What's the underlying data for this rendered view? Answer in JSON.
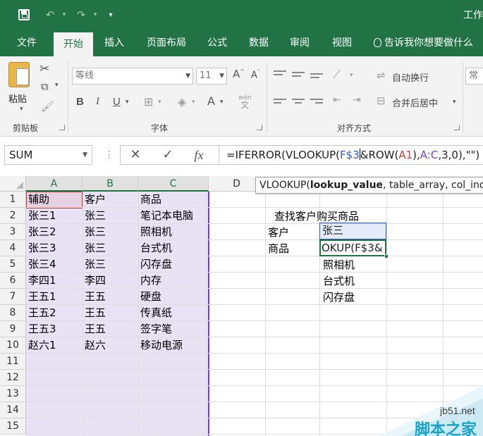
{
  "window": {
    "title": "工作",
    "qat": {
      "save_icon": "save-icon",
      "undo_icon": "undo-icon",
      "redo_icon": "redo-icon",
      "customize_icon": "chevron-down-icon"
    }
  },
  "tabs": [
    {
      "label": "文件"
    },
    {
      "label": "开始",
      "active": true
    },
    {
      "label": "插入"
    },
    {
      "label": "页面布局"
    },
    {
      "label": "公式"
    },
    {
      "label": "数据"
    },
    {
      "label": "审阅"
    },
    {
      "label": "视图"
    }
  ],
  "tell_me": "告诉我你想要做什么",
  "ribbon": {
    "clipboard": {
      "paste_label": "粘贴",
      "group_label": "剪贴板"
    },
    "font": {
      "name_value": "等线",
      "size_value": "11",
      "bold": "B",
      "italic": "I",
      "underline": "U",
      "grow": "A",
      "shrink": "A",
      "font_color": "A",
      "phonetic": "wén",
      "group_label": "字体"
    },
    "alignment": {
      "wrap_label": "自动换行",
      "merge_label": "合并后居中",
      "group_label": "对齐方式"
    },
    "number": {
      "format_value": "常规"
    }
  },
  "formula_bar": {
    "name_box": "SUM",
    "cancel": "✕",
    "enter": "✓",
    "fx": "fx",
    "formula_parts": [
      "=IFERROR(VLOOKUP(",
      "F$3",
      "&ROW(",
      "A1",
      "),",
      "A:C",
      ",3,0),\"\")"
    ]
  },
  "tooltip": {
    "func": "VLOOKUP(",
    "arg_bold": "lookup_value",
    "rest": ", table_array, col_ind"
  },
  "grid": {
    "columns": [
      "A",
      "B",
      "C",
      "D"
    ],
    "rows": [
      "1",
      "2",
      "3",
      "4",
      "5",
      "6",
      "7",
      "8",
      "9",
      "10",
      "11",
      "12",
      "13",
      "14",
      "15"
    ],
    "table": [
      [
        "辅助",
        "客户",
        "商品"
      ],
      [
        "张三1",
        "张三",
        "笔记本电脑"
      ],
      [
        "张三2",
        "张三",
        "照相机"
      ],
      [
        "张三3",
        "张三",
        "台式机"
      ],
      [
        "张三4",
        "张三",
        "闪存盘"
      ],
      [
        "李四1",
        "李四",
        "内存"
      ],
      [
        "王五1",
        "王五",
        "硬盘"
      ],
      [
        "王五2",
        "王五",
        "传真纸"
      ],
      [
        "王五3",
        "王五",
        "签字笔"
      ],
      [
        "赵六1",
        "赵六",
        "移动电源"
      ]
    ],
    "lookup": {
      "title": "查找客户购买商品",
      "customer_label": "客户",
      "customer_value": "张三",
      "goods_label": "商品",
      "editing_text": "OKUP(F$3&",
      "results": [
        "照相机",
        "台式机",
        "闪存盘"
      ]
    }
  },
  "watermark": {
    "url": "jb51.net",
    "cn": "脚本之家"
  }
}
